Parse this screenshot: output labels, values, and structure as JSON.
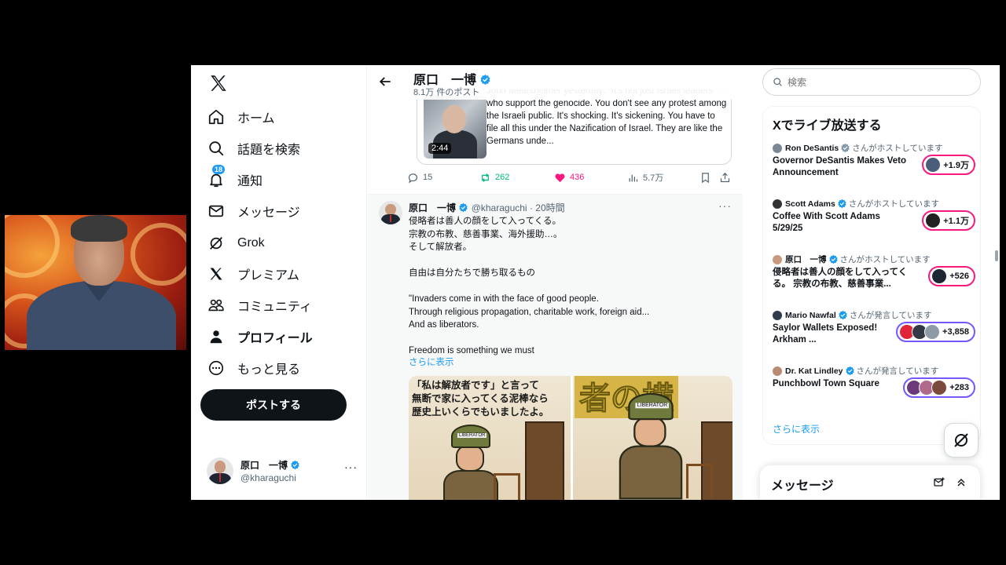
{
  "nav": {
    "items": [
      {
        "label": "ホーム",
        "icon": "home-icon"
      },
      {
        "label": "話題を検索",
        "icon": "search-icon"
      },
      {
        "label": "通知",
        "icon": "bell-icon",
        "badge": "18"
      },
      {
        "label": "メッセージ",
        "icon": "mail-icon"
      },
      {
        "label": "Grok",
        "icon": "grok-icon"
      },
      {
        "label": "プレミアム",
        "icon": "x-icon"
      },
      {
        "label": "コミュニティ",
        "icon": "community-icon"
      },
      {
        "label": "プロフィール",
        "icon": "profile-icon"
      },
      {
        "label": "もっと見る",
        "icon": "more-circle-icon"
      }
    ],
    "post_label": "ポストする",
    "account_name": "原口　一博",
    "account_handle": "@kharaguchi"
  },
  "profile_header": {
    "name": "原口　一博",
    "post_count": "8.1万 件のポスト"
  },
  "tweet1": {
    "quote_text": "John Mearsheimer yesterday: \"It's not just Israeli leaders who support the genocide. You don't see any protest among the Israeli public. It's shocking. It's sickening. You have to file all this under the Nazification of Israel. They are like the Germans unde...",
    "video_duration": "2:44",
    "replies": "15",
    "reposts": "262",
    "likes": "436",
    "views": "5.7万"
  },
  "tweet2": {
    "name": "原口　一博",
    "handle": "@kharaguchi",
    "time": "· 20時間",
    "lines": [
      "侵略者は善人の顔をして入ってくる。",
      "宗教の布教、慈善事業、海外援助…。",
      "そして解放者。",
      "",
      "自由は自分たちで勝ち取るもの",
      "",
      "\"Invaders come in with the face of good people.",
      "Through religious propagation, charitable work, foreign aid...",
      "And as liberators.",
      "",
      "Freedom is something we must"
    ],
    "show_more": "さらに表示",
    "image_text_left": [
      "「私は解放者です」と言って",
      "無断で家に入ってくる泥棒なら",
      "歴史上いくらでもいましたよ。"
    ],
    "image_text_right": "者の横",
    "helmet_label": "LIBERATOR"
  },
  "right": {
    "search_placeholder": "検索",
    "live_title": "Xでライブ放送する",
    "live": [
      {
        "host": "Ron DeSantis",
        "role": "さんがホストしています",
        "title": "Governor DeSantis Makes Veto Announcement",
        "count": "+1.9万",
        "pill": "pink"
      },
      {
        "host": "Scott Adams",
        "role": "さんがホストしています",
        "title": "Coffee With Scott Adams 5/29/25",
        "count": "+1.1万",
        "pill": "pink"
      },
      {
        "host": "原口　一博",
        "role": "さんがホストしています",
        "title": "侵略者は善人の顔をして入ってくる。 宗教の布教、慈善事業...",
        "count": "+526",
        "pill": "pink"
      },
      {
        "host": "Mario Nawfal",
        "role": "さんが発言しています",
        "title": "Saylor Wallets Exposed! Arkham ...",
        "count": "+3,858",
        "pill": "purple"
      },
      {
        "host": "Dr. Kat Lindley",
        "role": "さんが発言しています",
        "title": "Punchbowl Town Square",
        "count": "+283",
        "pill": "purple"
      }
    ],
    "show_more": "さらに表示",
    "messages_title": "メッセージ"
  },
  "colors": {
    "accent": "#1d9bf0",
    "like": "#f91880",
    "repost": "#00ba7c",
    "text": "#0f1419",
    "muted": "#536471"
  }
}
